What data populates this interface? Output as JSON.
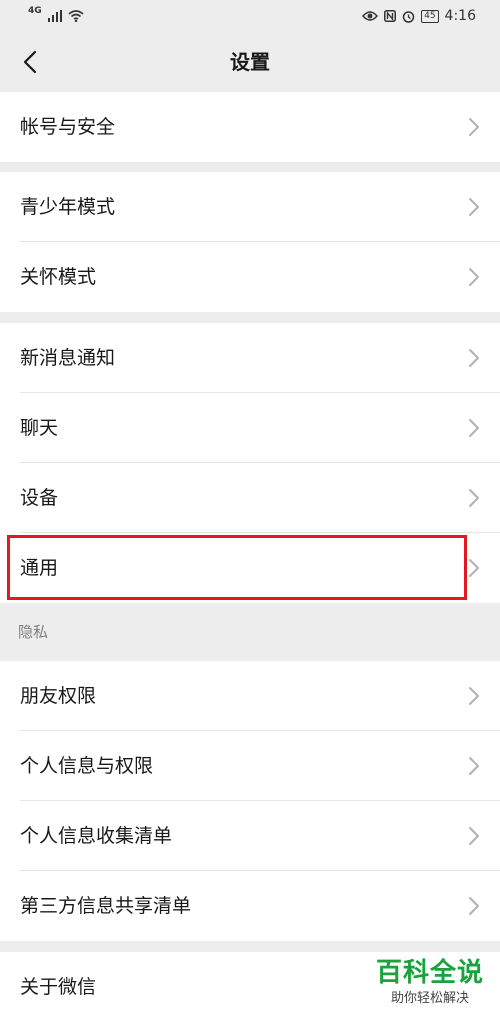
{
  "status_bar": {
    "network_type": "4G",
    "battery_level": "45",
    "time": "4:16"
  },
  "nav": {
    "title": "设置"
  },
  "groups": {
    "account": {
      "label": "帐号与安全"
    },
    "teen_mode": {
      "label": "青少年模式"
    },
    "care_mode": {
      "label": "关怀模式"
    },
    "notifications": {
      "label": "新消息通知"
    },
    "chat": {
      "label": "聊天"
    },
    "devices": {
      "label": "设备"
    },
    "general": {
      "label": "通用"
    },
    "privacy_header": "隐私",
    "friend_permissions": {
      "label": "朋友权限"
    },
    "personal_info_permissions": {
      "label": "个人信息与权限"
    },
    "personal_info_list": {
      "label": "个人信息收集清单"
    },
    "third_party_list": {
      "label": "第三方信息共享清单"
    },
    "about": {
      "label": "关于微信"
    }
  },
  "watermark": {
    "title": "百科全说",
    "subtitle": "助你轻松解决"
  },
  "colors": {
    "background": "#ededed",
    "highlight": "#e01a22",
    "watermark": "#1aa33c"
  }
}
